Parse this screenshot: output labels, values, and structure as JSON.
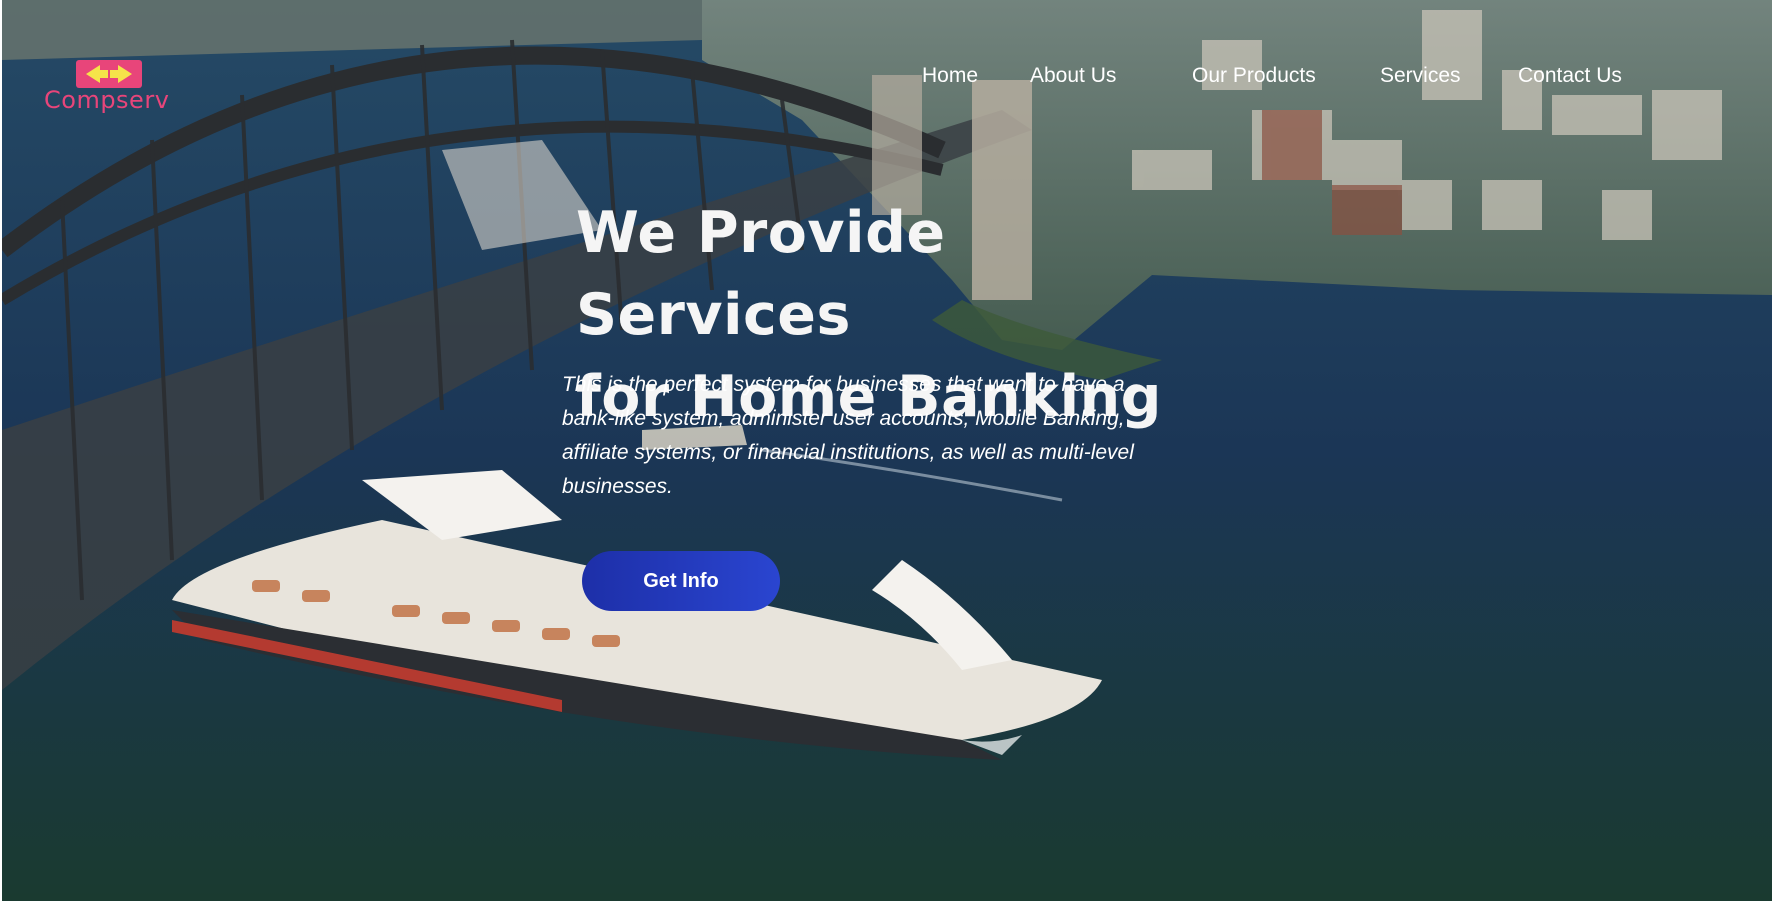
{
  "brand": {
    "name": "Compserv",
    "accent": "#e8457a"
  },
  "nav": {
    "items": [
      {
        "label": "Home"
      },
      {
        "label": "About Us"
      },
      {
        "label": "Our Products"
      },
      {
        "label": "Services"
      },
      {
        "label": "Contact Us"
      }
    ]
  },
  "hero": {
    "heading_line1": "We Provide Services",
    "heading_line2": "for Home Banking",
    "description": "This is the perfect system for businesses that want to have a bank-like system, administer user accounts, Mobile Banking, affiliate systems, or financial institutions, as well as multi-level businesses.",
    "cta_label": "Get Info",
    "cta_color": "#2a45d0"
  }
}
